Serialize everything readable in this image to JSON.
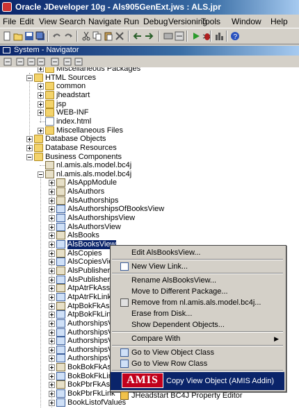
{
  "window": {
    "title": "Oracle JDeveloper 10g - Als905GenExt.jws : ALS.jpr"
  },
  "menu": [
    "File",
    "Edit",
    "View",
    "Search",
    "Navigate",
    "Run",
    "Debug",
    "Versioning",
    "Tools",
    "Window",
    "Help"
  ],
  "toolbar": {
    "icons": [
      "new-icon",
      "open-icon",
      "save-icon",
      "save-all-icon",
      "undo-icon",
      "redo-icon",
      "cut-icon",
      "copy-icon",
      "paste-icon",
      "delete-icon",
      "back-icon",
      "forward-icon",
      "make-icon",
      "rebuild-icon",
      "run-icon",
      "debug-icon",
      "profile-icon",
      "help-icon"
    ]
  },
  "navigator": {
    "title": "System - Navigator"
  },
  "tree": [
    {
      "label": "Miscellaneous Packages",
      "level": 2,
      "icon": "folder",
      "exp": "plus"
    },
    {
      "label": "HTML Sources",
      "level": 1,
      "icon": "folder",
      "exp": "minus"
    },
    {
      "label": "common",
      "level": 2,
      "icon": "folder",
      "exp": "plus"
    },
    {
      "label": "jheadstart",
      "level": 2,
      "icon": "folder",
      "exp": "plus"
    },
    {
      "label": "jsp",
      "level": 2,
      "icon": "folder",
      "exp": "plus"
    },
    {
      "label": "WEB-INF",
      "level": 2,
      "icon": "folder",
      "exp": "plus"
    },
    {
      "label": "index.html",
      "level": 2,
      "icon": "doc",
      "exp": ""
    },
    {
      "label": "Miscellaneous Files",
      "level": 2,
      "icon": "folder",
      "exp": "plus"
    },
    {
      "label": "Database Objects",
      "level": 1,
      "icon": "folder",
      "exp": "plus"
    },
    {
      "label": "Database Resources",
      "level": 1,
      "icon": "folder",
      "exp": "plus"
    },
    {
      "label": "Business Components",
      "level": 1,
      "icon": "folder",
      "exp": "minus"
    },
    {
      "label": "nl.amis.als.model.bc4j",
      "level": 2,
      "icon": "pkg",
      "exp": ""
    },
    {
      "label": "nl.amis.als.model.bc4j",
      "level": 2,
      "icon": "pkg",
      "exp": "minus"
    },
    {
      "label": "AlsAppModule",
      "level": 3,
      "icon": "bc",
      "exp": "plus"
    },
    {
      "label": "AlsAuthors",
      "level": 3,
      "icon": "bc",
      "exp": "plus"
    },
    {
      "label": "AlsAuthorships",
      "level": 3,
      "icon": "bc",
      "exp": "plus"
    },
    {
      "label": "AlsAuthorshipsOfBooksView",
      "level": 3,
      "icon": "view",
      "exp": "plus"
    },
    {
      "label": "AlsAuthorshipsView",
      "level": 3,
      "icon": "view",
      "exp": "plus"
    },
    {
      "label": "AlsAuthorsView",
      "level": 3,
      "icon": "view",
      "exp": "plus"
    },
    {
      "label": "AlsBooks",
      "level": 3,
      "icon": "bc",
      "exp": "plus"
    },
    {
      "label": "AlsBooksView",
      "level": 3,
      "icon": "view",
      "exp": "plus",
      "selected": true
    },
    {
      "label": "AlsCopies",
      "level": 3,
      "icon": "bc",
      "exp": "plus"
    },
    {
      "label": "AlsCopiesView",
      "level": 3,
      "icon": "view",
      "exp": "plus"
    },
    {
      "label": "AlsPublishers",
      "level": 3,
      "icon": "bc",
      "exp": "plus"
    },
    {
      "label": "AlsPublishersView",
      "level": 3,
      "icon": "view",
      "exp": "plus"
    },
    {
      "label": "AtpAtrFkAssoc",
      "level": 3,
      "icon": "bc",
      "exp": "plus"
    },
    {
      "label": "AtpAtrFkLink",
      "level": 3,
      "icon": "view",
      "exp": "plus"
    },
    {
      "label": "AtpBokFkAssoc",
      "level": 3,
      "icon": "bc",
      "exp": "plus"
    },
    {
      "label": "AtpBokFkLink",
      "level": 3,
      "icon": "view",
      "exp": "plus"
    },
    {
      "label": "AuthorshipsView",
      "level": 3,
      "icon": "view",
      "exp": "plus"
    },
    {
      "label": "AuthorshipsView",
      "level": 3,
      "icon": "view",
      "exp": "plus"
    },
    {
      "label": "AuthorshipsView",
      "level": 3,
      "icon": "view",
      "exp": "plus"
    },
    {
      "label": "AuthorshipsView",
      "level": 3,
      "icon": "view",
      "exp": "plus"
    },
    {
      "label": "AuthorshipsView",
      "level": 3,
      "icon": "view",
      "exp": "plus"
    },
    {
      "label": "BokBokFkAssoc",
      "level": 3,
      "icon": "bc",
      "exp": "plus"
    },
    {
      "label": "BokBokFkLink",
      "level": 3,
      "icon": "view",
      "exp": "plus"
    },
    {
      "label": "BokPbrFkAssoc",
      "level": 3,
      "icon": "bc",
      "exp": "plus"
    },
    {
      "label": "BokPbrFkLink",
      "level": 3,
      "icon": "view",
      "exp": "plus"
    },
    {
      "label": "BookListofValues",
      "level": 3,
      "icon": "view",
      "exp": "plus"
    }
  ],
  "tree_visible_labels": {
    "n0": "Miscellaneous Packages",
    "n20": "AlsBooksVi",
    "n22": "AlsCopiesV",
    "n23": "AlsPublishe",
    "n24": "AlsPublishe",
    "n25": "AtpAtrFkAs",
    "n26": "AtpAtrFkLin",
    "n27": "AtpBokFkA",
    "n28": "AtpBokFkLi",
    "n29": "AuthorshipO",
    "n30": "Authorships",
    "n31": "Authorships",
    "n32": "Authorships",
    "n33": "Authorships",
    "n34": "BokBokFkA",
    "n35": "BokBokFkL",
    "n36": "BokPbrFkAssoc",
    "n37": "BokPbrFkLink",
    "n38": "BookListofValues"
  },
  "context_menu": [
    {
      "label": "Edit AlsBooksView...",
      "icon": ""
    },
    {
      "sep": true
    },
    {
      "label": "New View Link...",
      "icon": "new-view-link-icon"
    },
    {
      "sep": true
    },
    {
      "label": "Rename AlsBooksView...",
      "icon": ""
    },
    {
      "label": "Move to Different Package...",
      "icon": ""
    },
    {
      "label": "Remove from nl.amis.als.model.bc4j...",
      "icon": "remove-icon"
    },
    {
      "label": "Erase from Disk...",
      "icon": ""
    },
    {
      "label": "Show Dependent Objects...",
      "icon": ""
    },
    {
      "sep": true
    },
    {
      "label": "Compare With",
      "icon": "",
      "submenu": true
    },
    {
      "sep": true
    },
    {
      "label": "Go to View Object Class",
      "icon": "java-class-icon"
    },
    {
      "label": "Go to View Row Class",
      "icon": "java-class-icon"
    },
    {
      "sep": true
    },
    {
      "label": "Copy View Object (AMIS Addin)",
      "icon": "amis-logo",
      "highlight": true
    },
    {
      "label": "JHeadstart BC4J Property Editor",
      "icon": "jheadstart-icon"
    }
  ],
  "amis_logo_text": "AMIS",
  "colors": {
    "selection": "#0a246a",
    "title_start": "#0a246a",
    "title_end": "#a6caf0",
    "face": "#d4d0c8",
    "amis_red": "#c2001c"
  }
}
